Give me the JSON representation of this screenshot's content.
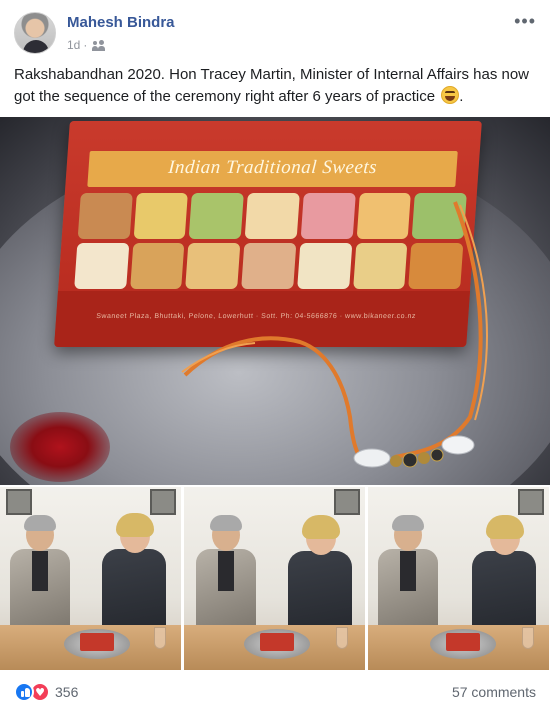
{
  "post": {
    "author": "Mahesh Bindra",
    "time": "1d",
    "separator": "·",
    "audience_icon": "friends-icon",
    "more_icon": "more-options-icon",
    "more_glyph": "•••",
    "text": "Rakshabandhan 2020. Hon Tracey Martin, Minister of Internal Affairs has now got the sequence of the ceremony right after 6 years of practice",
    "emoji_icon": "laughing-emoji-icon"
  },
  "main_photo": {
    "box_title": "Indian Traditional Sweets",
    "box_address": "Swaneet Plaza, Bhuttaki, Pelone, Lowerhutt · Sott. Ph: 04-5666876 · www.bikaneer.co.nz"
  },
  "footer": {
    "reactions": [
      "like-icon",
      "love-icon"
    ],
    "reaction_count": "356",
    "comments": "57 comments"
  },
  "colors": {
    "link_blue": "#385898",
    "meta_gray": "#90949c",
    "like_blue": "#1877f2",
    "love_red": "#f33e58"
  }
}
